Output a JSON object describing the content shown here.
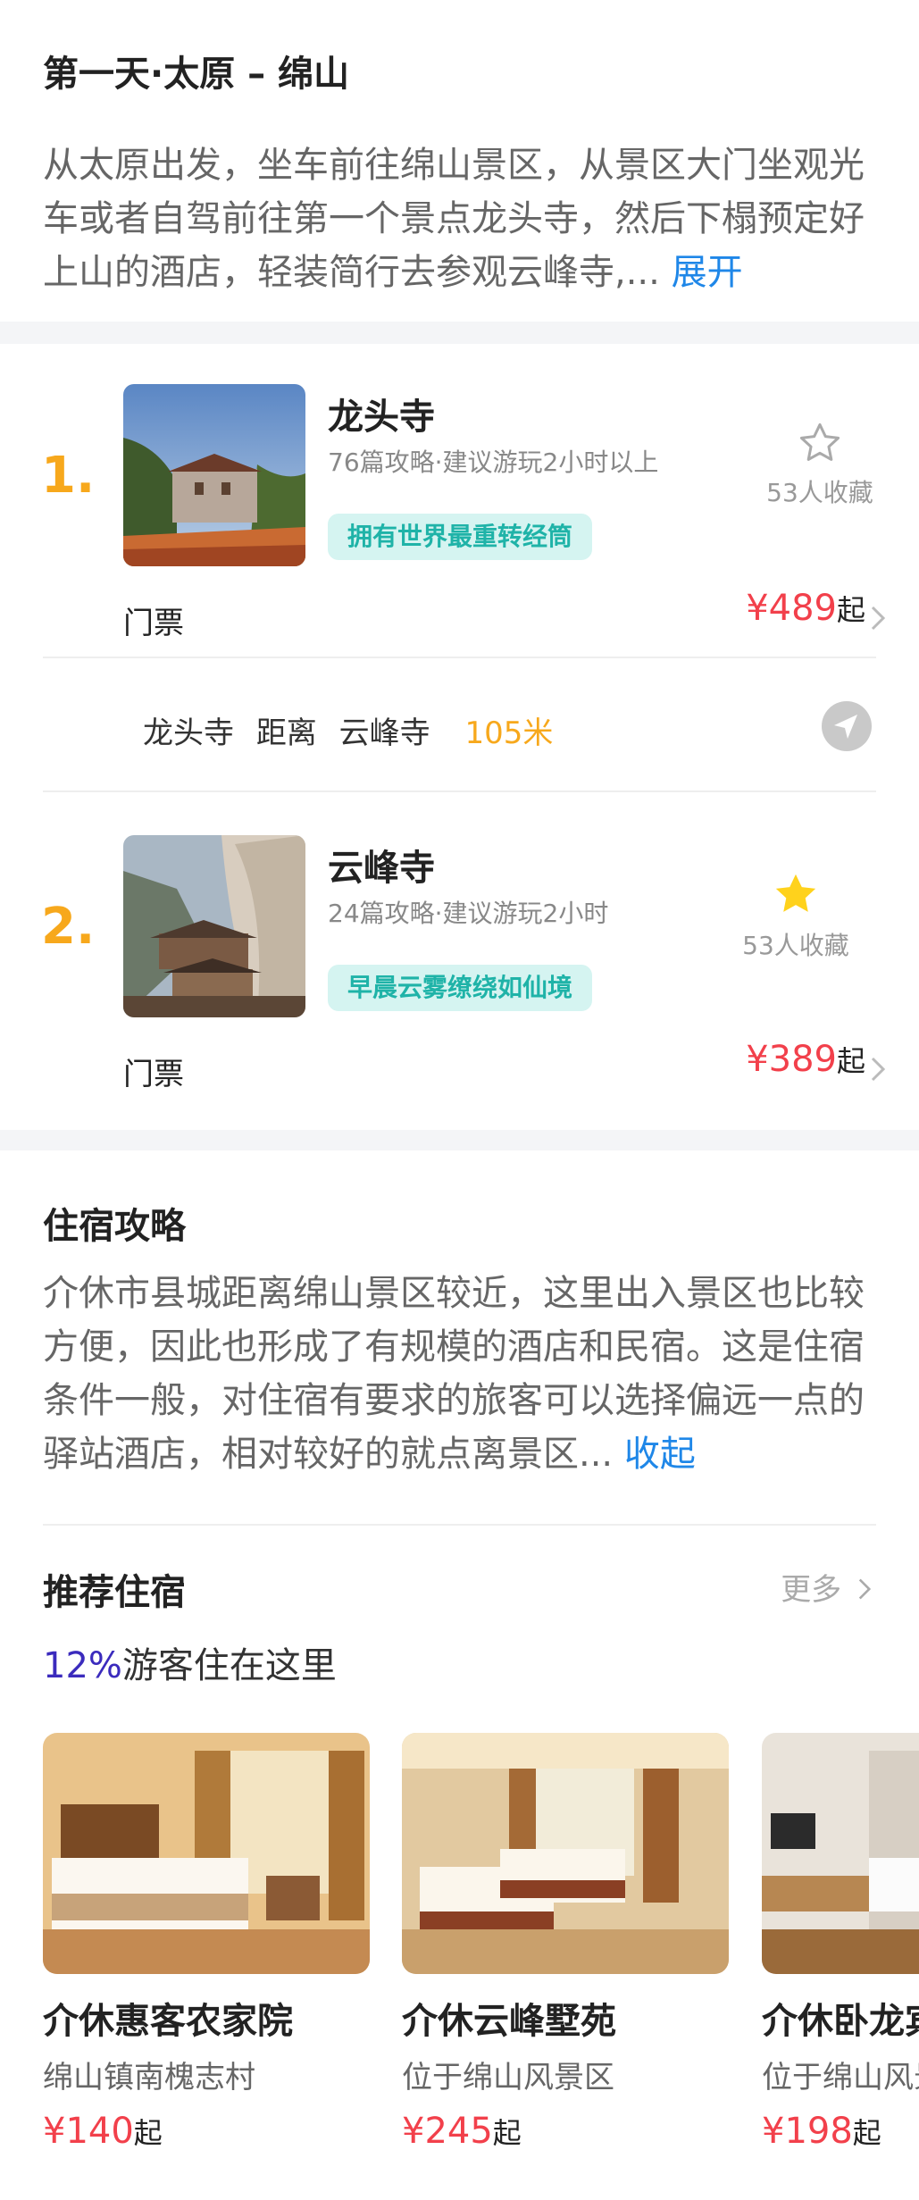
{
  "day": {
    "title": "第一天·太原 – 绵山",
    "description": "从太原出发，坐车前往绵山景区，从景区大门坐观光车或者自驾前往第一个景点龙头寺，然后下榻预定好上山的酒店，轻装简行去参观云峰寺,...",
    "expand_label": "展开"
  },
  "spots": [
    {
      "number": "1.",
      "name": "龙头寺",
      "meta": "76篇攻略·建议游玩2小时以上",
      "tag": "拥有世界最重转经筒",
      "favorited": false,
      "fav_count": "53人收藏",
      "ticket_label": "门票",
      "price": "¥489",
      "price_suffix": "起"
    },
    {
      "number": "2.",
      "name": "云峰寺",
      "meta": "24篇攻略·建议游玩2小时",
      "tag": "早晨云雾缭绕如仙境",
      "favorited": true,
      "fav_count": "53人收藏",
      "ticket_label": "门票",
      "price": "¥389",
      "price_suffix": "起"
    }
  ],
  "distance": {
    "from": "龙头寺",
    "word": "距离",
    "to": "云峰寺",
    "value": "105米"
  },
  "stay": {
    "title": "住宿攻略",
    "description": "介休市县城距离绵山景区较近，这里出入景区也比较方便，因此也形成了有规模的酒店和民宿。这是住宿条件一般，对住宿有要求的旅客可以选择偏远一点的驿站酒店，相对较好的就点离景区...",
    "collapse_label": "收起",
    "recommend_title": "推荐住宿",
    "more_label": "更多",
    "percent": "12%",
    "percent_text": "游客住在这里",
    "hotels": [
      {
        "name": "介休惠客农家院",
        "location": "绵山镇南槐志村",
        "price": "¥140",
        "price_suffix": "起"
      },
      {
        "name": "介休云峰墅苑",
        "location": "位于绵山风景区",
        "price": "¥245",
        "price_suffix": "起"
      },
      {
        "name": "介休卧龙宾馆",
        "location": "位于绵山风景区",
        "price": "¥198",
        "price_suffix": "起"
      }
    ]
  },
  "colors": {
    "accent_orange": "#f7a81c",
    "price_red": "#f2404b",
    "link_blue": "#1f87e8",
    "tag_teal": "#1fb3a8",
    "star_yellow": "#ffd21c"
  }
}
